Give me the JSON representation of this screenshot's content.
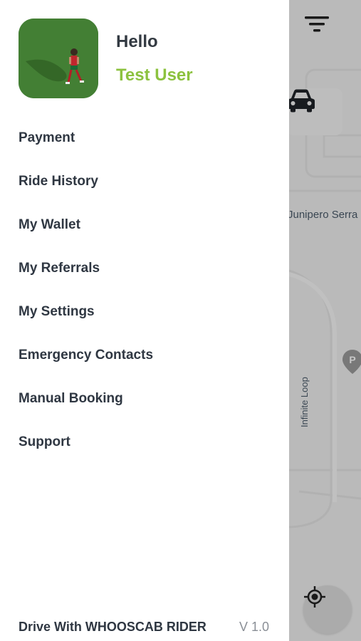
{
  "drawer": {
    "greeting": "Hello",
    "user_name": "Test User",
    "menu": [
      {
        "label": "Payment"
      },
      {
        "label": "Ride History"
      },
      {
        "label": "My Wallet"
      },
      {
        "label": "My Referrals"
      },
      {
        "label": "My Settings"
      },
      {
        "label": "Emergency Contacts"
      },
      {
        "label": "Manual Booking"
      },
      {
        "label": "Support"
      }
    ],
    "footer_link": "Drive With WHOOSCAB RIDER",
    "version": "V 1.0"
  },
  "map": {
    "street_label": "Junipero Serra F",
    "loop_label": "Infinite Loop",
    "poi_letter": "P"
  },
  "colors": {
    "accent": "#8cc23f",
    "text": "#2f3742"
  }
}
